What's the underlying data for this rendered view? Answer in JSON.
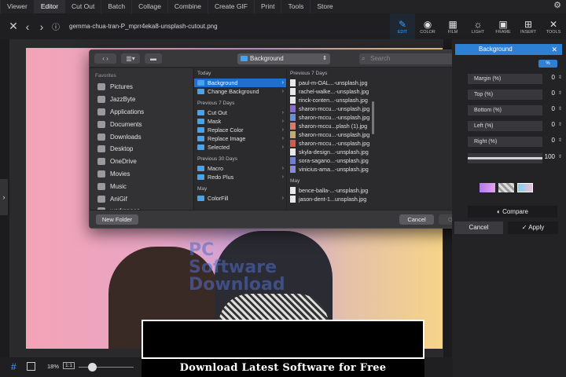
{
  "menu": [
    "Viewer",
    "Editor",
    "Cut Out",
    "Batch",
    "Collage",
    "Combine",
    "Create GIF",
    "Print",
    "Tools",
    "Store"
  ],
  "toolbar": {
    "filename": "gemma-chua-tran-P_mprr4eka8-unsplash-cutout.png"
  },
  "tools": [
    {
      "label": "EDIT",
      "icon": "edit-icon"
    },
    {
      "label": "COLOR",
      "icon": "color-icon"
    },
    {
      "label": "FILM",
      "icon": "film-icon"
    },
    {
      "label": "LIGHT",
      "icon": "light-icon"
    },
    {
      "label": "FRAME",
      "icon": "frame-icon"
    },
    {
      "label": "INSERT",
      "icon": "insert-icon"
    },
    {
      "label": "TOOLS",
      "icon": "tools-icon"
    }
  ],
  "dialog": {
    "path": "Background",
    "search_placeholder": "Search",
    "favorites_header": "Favorites",
    "favorites": [
      "Pictures",
      "JazzByte",
      "Applications",
      "Documents",
      "Downloads",
      "Desktop",
      "OneDrive",
      "Movies",
      "Music",
      "AniGif",
      "workspace"
    ],
    "col1_groups": [
      {
        "header": "Today",
        "items": [
          "Background",
          "Change Background"
        ]
      },
      {
        "header": "Previous 7 Days",
        "items": [
          "Cut Out",
          "Mask",
          "Replace Color",
          "Replace Image",
          "Selected"
        ]
      },
      {
        "header": "Previous 30 Days",
        "items": [
          "Macro",
          "Redo Plus"
        ]
      },
      {
        "header": "May",
        "items": [
          "ColorFill"
        ]
      }
    ],
    "col2_header": "Previous 7 Days",
    "col2_items": [
      "paul-m-OAL...-unsplash.jpg",
      "rachel-walke...-unsplash.jpg",
      "rinck-conten...-unsplash.jpg",
      "sharon-mccu...-unsplash.jpg",
      "sharon-mccu...-unsplash.jpg",
      "sharon-mccu...plash (1).jpg",
      "sharon-mccu...-unsplash.jpg",
      "sharon-mccu...-unsplash.jpg",
      "skyla-design...-unsplash.jpg",
      "sora-sagano...-unsplash.jpg",
      "vinicius-ama...-unsplash.jpg"
    ],
    "col2_header2": "May",
    "col2_items2": [
      "bence-balla-...-unsplash.jpg",
      "jason-dent-1...unsplash.jpg"
    ],
    "new_folder": "New Folder",
    "cancel": "Cancel",
    "open": "Open"
  },
  "panel": {
    "title": "Background",
    "toggle": "%",
    "rows": [
      {
        "label": "Margin (%)",
        "value": "0"
      },
      {
        "label": "Top (%)",
        "value": "0"
      },
      {
        "label": "Bottom (%)",
        "value": "0"
      },
      {
        "label": "Left (%)",
        "value": "0"
      },
      {
        "label": "Right (%)",
        "value": "0"
      }
    ],
    "slider_value": "100",
    "slider_fraction": 1.0,
    "compare": "Compare",
    "cancel": "Cancel",
    "apply": "Apply"
  },
  "bottom": {
    "zoom": "18%",
    "ratio": "1:1"
  },
  "watermark": {
    "line1": "PC",
    "line2": "Software",
    "line3": "Download"
  },
  "banner": "Download Latest Software for Free"
}
